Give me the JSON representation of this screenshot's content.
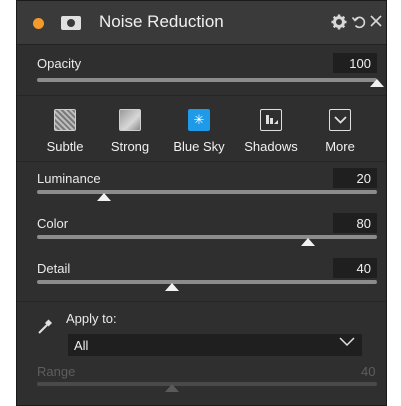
{
  "header": {
    "title": "Noise Reduction",
    "accent_color": "#f39a2c"
  },
  "opacity": {
    "label": "Opacity",
    "value": "100",
    "level": 1.0
  },
  "presets": [
    {
      "label": "Subtle",
      "icon": "subtle-preset-icon"
    },
    {
      "label": "Strong",
      "icon": "strong-preset-icon"
    },
    {
      "label": "Blue Sky",
      "icon": "blue-sky-preset-icon",
      "selected": true
    },
    {
      "label": "Shadows",
      "icon": "shadows-preset-icon"
    },
    {
      "label": "More",
      "icon": "chevron-down-icon"
    }
  ],
  "luminance": {
    "label": "Luminance",
    "value": "20",
    "level": 0.2
  },
  "color": {
    "label": "Color",
    "value": "80",
    "level": 0.8
  },
  "detail": {
    "label": "Detail",
    "value": "40",
    "level": 0.4
  },
  "apply": {
    "label": "Apply to:",
    "selected": "All"
  },
  "range": {
    "label": "Range",
    "value": "40",
    "level": 0.4,
    "disabled": true
  },
  "colors": {
    "selected_preset": "#1e9ae8",
    "panel": "#2f2f2f"
  }
}
